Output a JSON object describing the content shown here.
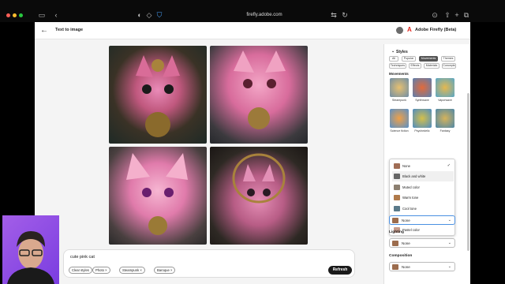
{
  "browser": {
    "url": "firefly.adobe.com"
  },
  "header": {
    "back_label": "←",
    "title": "Text to image",
    "brand": "Adobe Firefly (Beta)"
  },
  "prompt": {
    "text": "cute pink cat",
    "chips": [
      "Clear styles",
      "Photo",
      "Steampunk",
      "Baroque"
    ],
    "refresh_label": "Refresh"
  },
  "styles_panel": {
    "section_title": "Styles",
    "tabs": [
      "All",
      "Popular",
      "Movements",
      "Themes",
      "Techniques",
      "Effects",
      "Materials",
      "Concepts"
    ],
    "selected_tab": "Movements",
    "subheading": "Movements",
    "thumbs": [
      "Steampunk",
      "Synthwave",
      "Vaporwave",
      "Science fiction",
      "Psychedelic",
      "Fantasy"
    ],
    "dropdown_options": [
      "None",
      "Black and white",
      "Muted color",
      "Warm tone",
      "Cool tone",
      "Vibrant color",
      "Pastel color"
    ],
    "dropdown_selected": "None",
    "color_select_value": "None",
    "lighting_label": "Lighting",
    "lighting_value": "None",
    "composition_label": "Composition",
    "composition_value": "None"
  },
  "colors": {
    "accent": "#e1251b",
    "tab_selected": "#555555",
    "presenter_bg": "#9a55e6"
  }
}
